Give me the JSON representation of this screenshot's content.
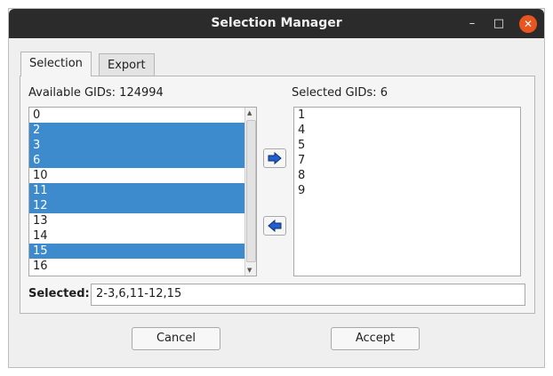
{
  "window": {
    "title": "Selection Manager",
    "controls": {
      "minimize": "–",
      "maximize": "□",
      "close": "✕"
    }
  },
  "tabs": [
    {
      "label": "Selection",
      "active": true
    },
    {
      "label": "Export",
      "active": false
    }
  ],
  "available": {
    "label": "Available GIDs: 124994",
    "items": [
      {
        "value": "0",
        "selected": false
      },
      {
        "value": "2",
        "selected": true
      },
      {
        "value": "3",
        "selected": true
      },
      {
        "value": "6",
        "selected": true
      },
      {
        "value": "10",
        "selected": false
      },
      {
        "value": "11",
        "selected": true
      },
      {
        "value": "12",
        "selected": true
      },
      {
        "value": "13",
        "selected": false
      },
      {
        "value": "14",
        "selected": false
      },
      {
        "value": "15",
        "selected": true
      },
      {
        "value": "16",
        "selected": false
      }
    ]
  },
  "selected": {
    "label": "Selected GIDs: 6",
    "items": [
      "1",
      "4",
      "5",
      "7",
      "8",
      "9"
    ]
  },
  "selection_field": {
    "label": "Selected:",
    "value": "2-3,6,11-12,15"
  },
  "buttons": {
    "cancel": "Cancel",
    "accept": "Accept",
    "move_right_icon": "arrow-right-icon",
    "move_left_icon": "arrow-left-icon"
  },
  "colors": {
    "highlight": "#3d8bcd",
    "arrow": "#1f5fcf",
    "close_button": "#e9541f",
    "titlebar": "#2b2b2b"
  }
}
